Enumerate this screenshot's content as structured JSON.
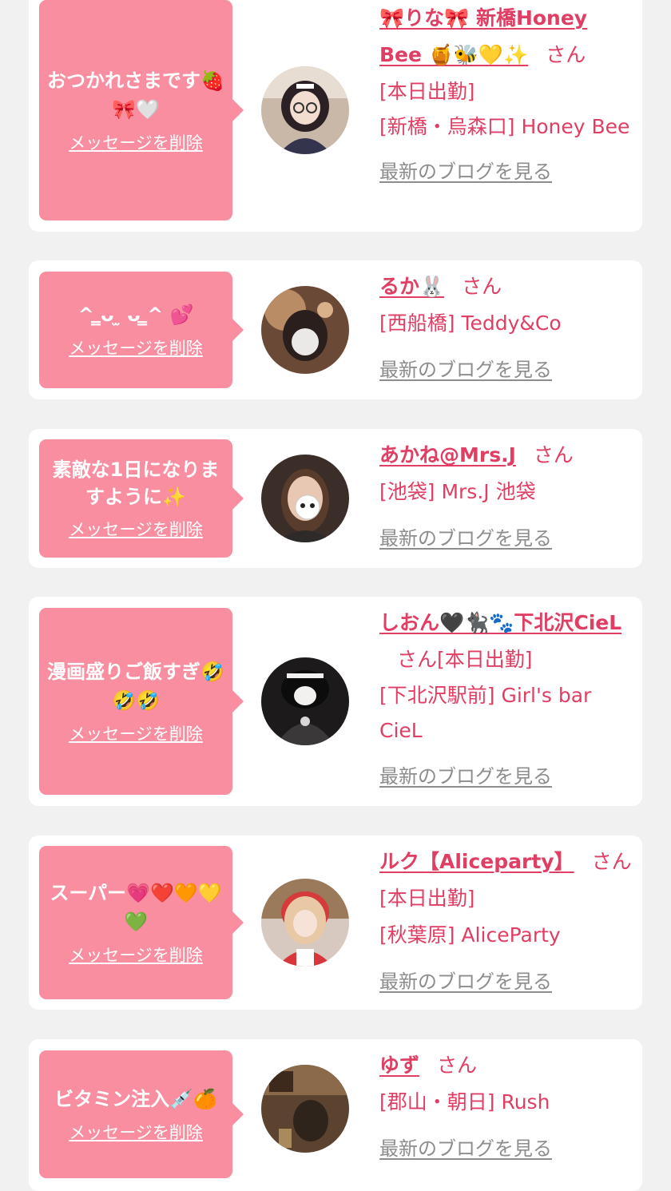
{
  "colors": {
    "page_background": "#f1f1f1",
    "card_background": "#ffffff",
    "bubble": "#f98ea0",
    "accent_text": "#e03e63",
    "blog_link": "#8d8d8d"
  },
  "delete_label": "メッセージを削除",
  "blog_label": "最新のブログを見る",
  "honorific": "さん",
  "cards": [
    {
      "message": "おつかれさまです🍓🎀🤍",
      "name": "🎀りな🎀 新橋Honey Bee 🍯🐝💛✨",
      "status": "",
      "lines": [
        "[本日出勤]",
        "[新橋・烏森口] Honey Bee"
      ],
      "avatar_icon": "maid-glasses-avatar"
    },
    {
      "message": "^ ̳ᴗ ̫ ᴗ ̳^ 💕",
      "name": "るか🐰",
      "status": "",
      "lines": [
        "[西船橋] Teddy&Co"
      ],
      "avatar_icon": "blurred-face-avatar"
    },
    {
      "message": "素敵な1日になりますように✨",
      "name": "あかね@Mrs.J",
      "status": "",
      "lines": [
        "[池袋] Mrs.J 池袋"
      ],
      "avatar_icon": "panda-sticker-avatar"
    },
    {
      "message": "漫画盛りご飯すぎ🤣🤣🤣",
      "name": "しおん🖤🐈‍⬛🐾下北沢CieL",
      "status": "[本日出勤]",
      "lines": [
        "[下北沢駅前] Girl's bar CieL"
      ],
      "avatar_icon": "gothic-outfit-avatar"
    },
    {
      "message": "スーパー💗❤️🧡💛💚",
      "name": "ルク【Aliceparty】",
      "status": "[本日出勤]",
      "lines": [
        "[秋葉原] AliceParty"
      ],
      "avatar_icon": "red-maid-avatar"
    },
    {
      "message": "ビタミン注入💉🍊",
      "name": "ゆず",
      "status": "",
      "lines": [
        "[郡山・朝日] Rush"
      ],
      "avatar_icon": "bar-interior-avatar"
    }
  ]
}
